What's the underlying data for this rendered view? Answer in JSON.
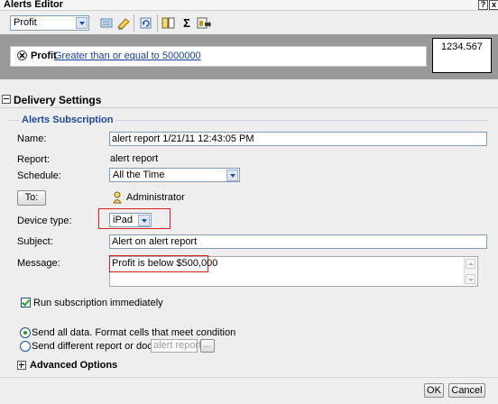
{
  "window": {
    "title": "Alerts Editor",
    "help_label": "?",
    "close_label": "x"
  },
  "toolbar": {
    "metric_select_value": "Profit",
    "icons": [
      "filter-icon",
      "highlight-icon",
      "refresh-icon",
      "columns-icon",
      "sum-icon",
      "export-icon"
    ]
  },
  "condition": {
    "metric": "Profit",
    "rule_link": "Greater than or equal to 5000000",
    "value": "1234.567"
  },
  "delivery": {
    "section_title": "Delivery Settings",
    "subscription_title": "Alerts Subscription",
    "name_label": "Name:",
    "name_value": "alert report 1/21/11 12:43:05 PM",
    "report_label": "Report:",
    "report_value": "alert report",
    "schedule_label": "Schedule:",
    "schedule_value": "All the Time",
    "to_button": "To:",
    "recipient": "Administrator",
    "device_label": "Device type:",
    "device_value": "iPad",
    "subject_label": "Subject:",
    "subject_value": "Alert on alert report",
    "message_label": "Message:",
    "message_value": "Profit is below $500,000",
    "run_immediately": "Run subscription immediately",
    "option_send_all": "Send all data. Format cells that meet condition",
    "option_send_different": "Send different report or document",
    "different_report_value": "alert report",
    "browse_label": "...",
    "advanced_options": "Advanced Options"
  },
  "footer": {
    "ok_label": "OK",
    "cancel_label": "Cancel"
  },
  "colors": {
    "condition_band": "#999999",
    "link": "#1a3fa6",
    "group_title": "#1e4799",
    "highlight_frame": "#d8201f"
  }
}
